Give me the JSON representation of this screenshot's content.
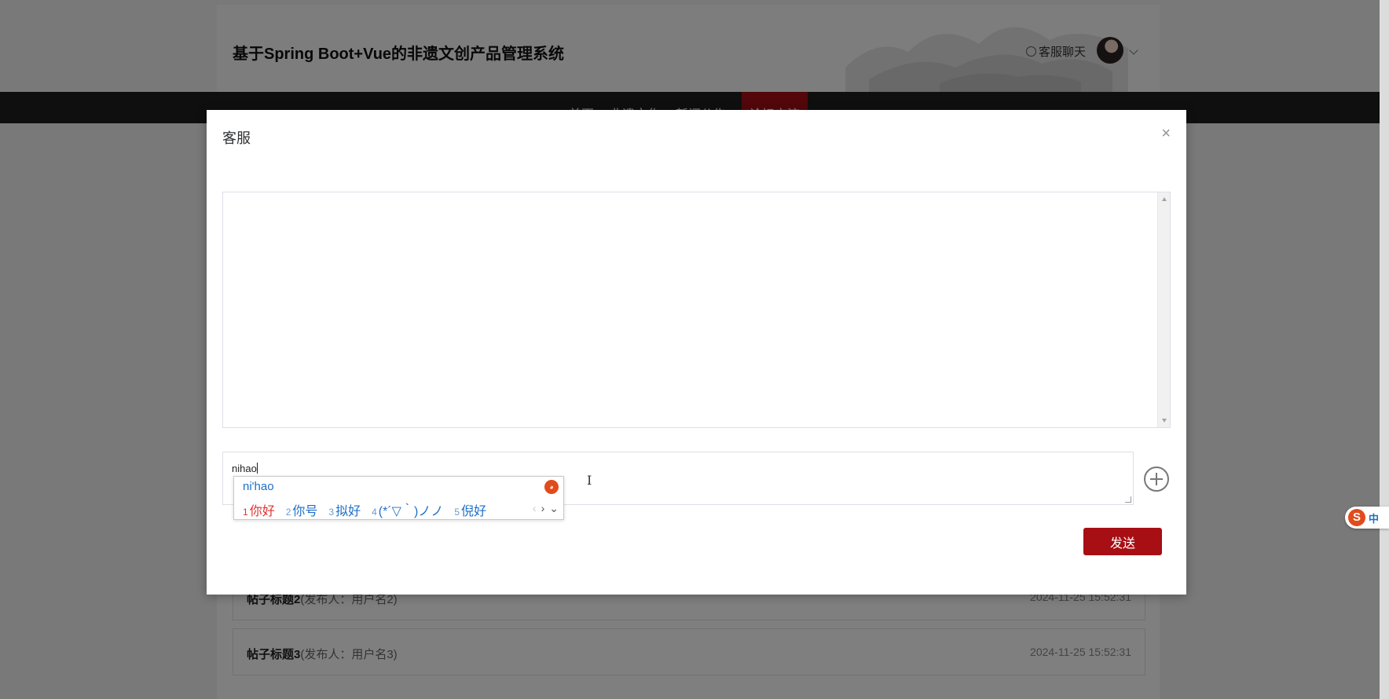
{
  "site": {
    "title": "基于Spring Boot+Vue的非遗文创产品管理系统",
    "chat_link": "客服聊天"
  },
  "nav": {
    "items": [
      {
        "label": "首页"
      },
      {
        "label": "非遗文化"
      },
      {
        "label": "新闻公告"
      },
      {
        "label": "论坛交流",
        "active": true
      }
    ]
  },
  "posts": [
    {
      "title": "帖子标题2",
      "author": "(发布人：用户名2)",
      "time": "2024-11-25 15:52:31"
    },
    {
      "title": "帖子标题3",
      "author": "(发布人：用户名3)",
      "time": "2024-11-25 15:52:31"
    }
  ],
  "dialog": {
    "title": "客服",
    "close": "×",
    "input_value": "nihao",
    "send_label": "发送"
  },
  "ime": {
    "pinyin": "ni'hao",
    "candidates": [
      {
        "n": "1",
        "text": "你好"
      },
      {
        "n": "2",
        "text": "你号"
      },
      {
        "n": "3",
        "text": "拟好"
      },
      {
        "n": "4",
        "text": "(*´▽｀)ノノ"
      },
      {
        "n": "5",
        "text": "倪好"
      }
    ],
    "prev": "‹",
    "next": "›",
    "expand": "⌄"
  },
  "sogou": {
    "logo": "S",
    "mode": "中"
  },
  "colors": {
    "accent": "#a70f14",
    "nav_bg": "#1f1f1f",
    "ime_text": "#1d6fc7",
    "ime_first": "#e0322e"
  }
}
